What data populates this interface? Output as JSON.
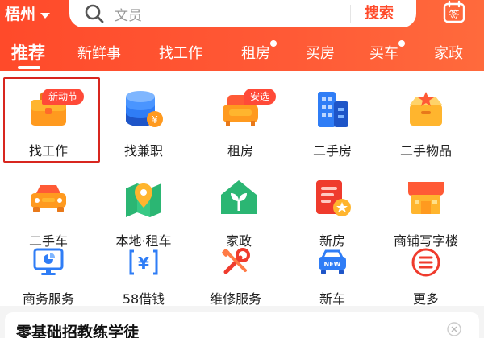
{
  "header": {
    "city": "梧州",
    "search_placeholder": "文员",
    "search_button": "搜索",
    "signin_label": "签"
  },
  "tabs": [
    {
      "label": "推荐",
      "active": true,
      "dot": false
    },
    {
      "label": "新鲜事",
      "active": false,
      "dot": false
    },
    {
      "label": "找工作",
      "active": false,
      "dot": false
    },
    {
      "label": "租房",
      "active": false,
      "dot": true
    },
    {
      "label": "买房",
      "active": false,
      "dot": false
    },
    {
      "label": "买车",
      "active": false,
      "dot": true
    },
    {
      "label": "家政",
      "active": false,
      "dot": false
    }
  ],
  "services": {
    "row1": [
      {
        "label": "找工作",
        "icon": "briefcase-icon",
        "badge": "新动节"
      },
      {
        "label": "找兼职",
        "icon": "coins-icon",
        "badge": ""
      },
      {
        "label": "租房",
        "icon": "sofa-icon",
        "badge": "安选"
      },
      {
        "label": "二手房",
        "icon": "buildings-icon",
        "badge": ""
      },
      {
        "label": "二手物品",
        "icon": "box-icon",
        "badge": ""
      }
    ],
    "row2": [
      {
        "label": "二手车",
        "icon": "car-icon"
      },
      {
        "label": "本地·租车",
        "icon": "map-pin-icon"
      },
      {
        "label": "家政",
        "icon": "house-leaf-icon"
      },
      {
        "label": "新房",
        "icon": "document-house-icon"
      },
      {
        "label": "商铺写字楼",
        "icon": "storefront-icon"
      }
    ],
    "row3": [
      {
        "label": "商务服务",
        "icon": "monitor-chart-icon"
      },
      {
        "label": "58借钱",
        "icon": "yuan-card-icon"
      },
      {
        "label": "维修服务",
        "icon": "tools-icon"
      },
      {
        "label": "新车",
        "icon": "new-car-icon"
      },
      {
        "label": "更多",
        "icon": "more-icon"
      }
    ]
  },
  "card": {
    "title": "零基础招教练学徒"
  },
  "colors": {
    "brand": "#ff4a2a",
    "badge": "#ff4a38",
    "icon_blue": "#2f7df6",
    "icon_orange": "#ff8a1f",
    "icon_red": "#ef3b2d"
  }
}
